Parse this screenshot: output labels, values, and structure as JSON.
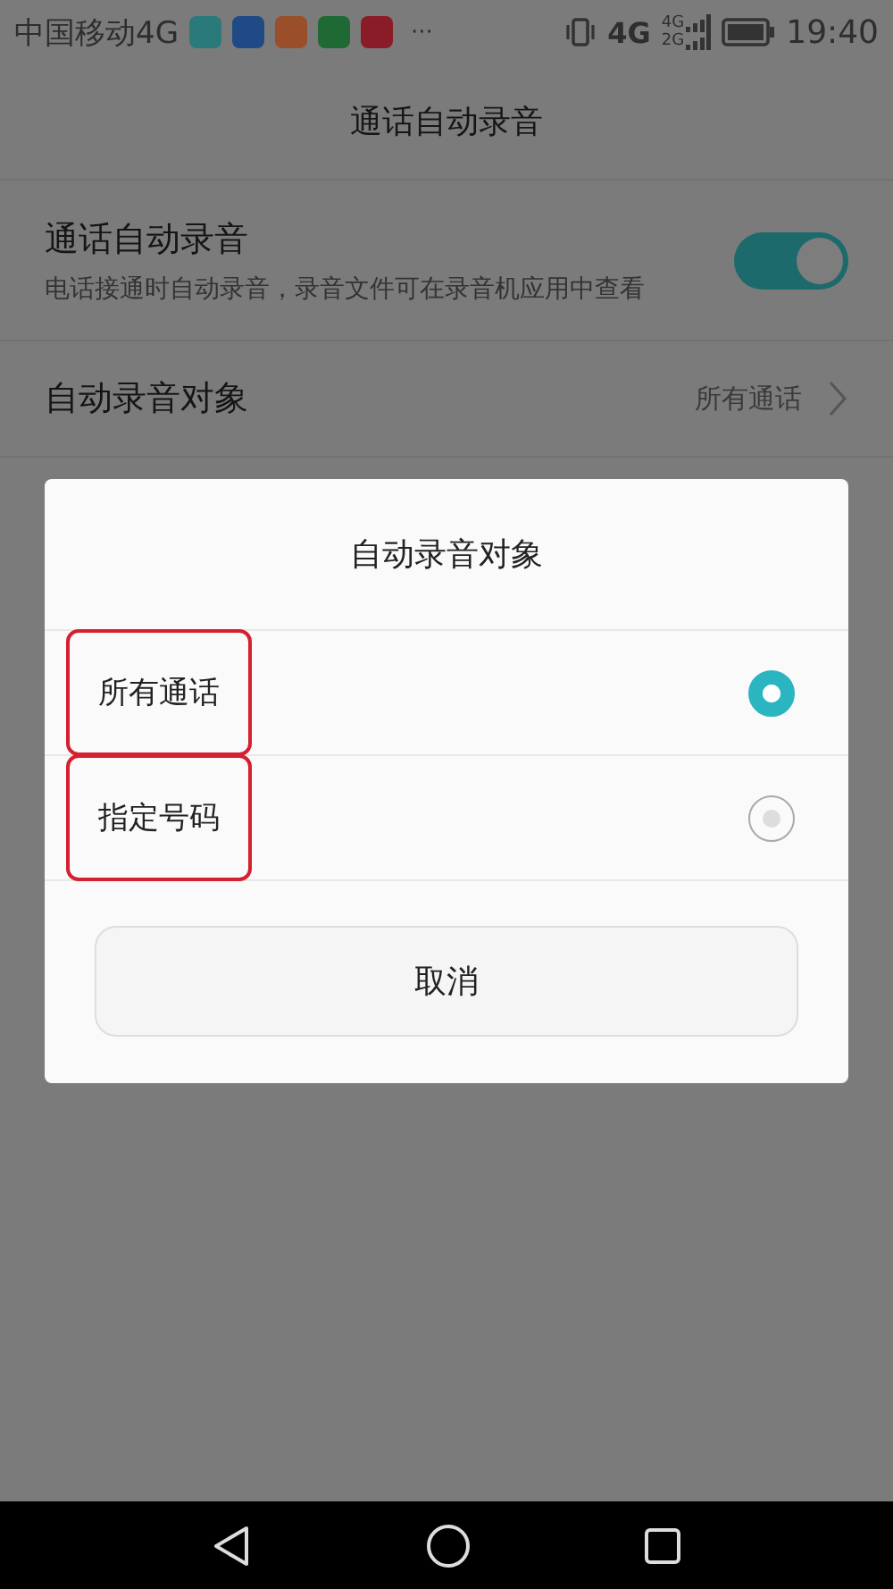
{
  "status_bar": {
    "carrier": "中国移动4G",
    "app_icons": [
      {
        "color": "#2a7a7b"
      },
      {
        "color": "#1f4a86"
      },
      {
        "color": "#9a4e2a"
      },
      {
        "color": "#1f6a34"
      },
      {
        "color": "#8a1c28"
      }
    ],
    "more": "···",
    "network": "4G",
    "sim_labels": [
      "4G",
      "2G"
    ],
    "time": "19:40"
  },
  "header": {
    "title": "通话自动录音"
  },
  "settings": [
    {
      "kind": "toggle",
      "title": "通话自动录音",
      "subtitle": "电话接通时自动录音，录音文件可在录音机应用中查看",
      "on": true
    },
    {
      "kind": "link",
      "title": "自动录音对象",
      "value": "所有通话"
    }
  ],
  "dialog": {
    "title": "自动录音对象",
    "options": [
      {
        "label": "所有通话",
        "selected": true,
        "highlighted": true
      },
      {
        "label": "指定号码",
        "selected": false,
        "highlighted": true
      }
    ],
    "cancel": "取消"
  }
}
